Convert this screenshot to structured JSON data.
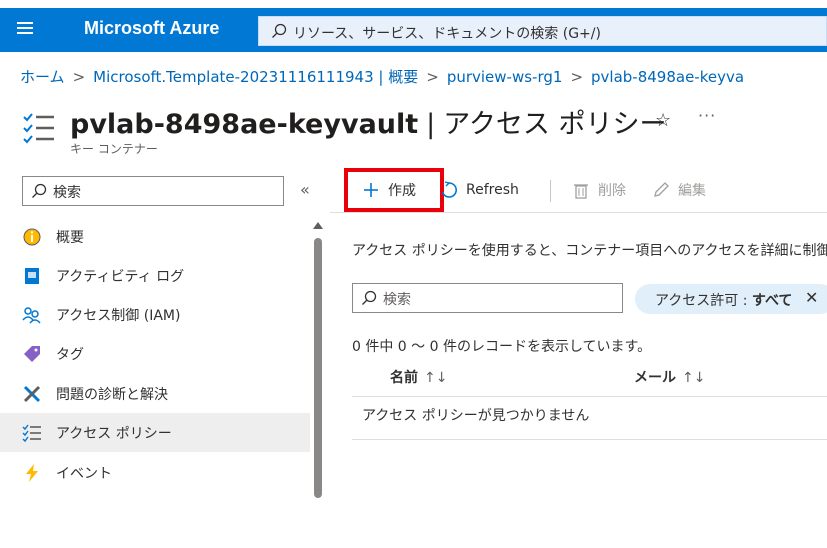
{
  "topbar": {
    "menu_icon": "hamburger-icon",
    "brand": "Microsoft Azure",
    "search_icon": "search-icon",
    "search_placeholder": "リソース、サービス、ドキュメントの検索 (G+/)"
  },
  "breadcrumb": {
    "items": [
      "ホーム",
      "Microsoft.Template-20231116111943 | 概要",
      "purview-ws-rg1",
      "pvlab-8498ae-keyva"
    ]
  },
  "header": {
    "icon": "access-policies-icon",
    "resource_name": "pvlab-8498ae-keyvault",
    "separator": "|",
    "page_name": "アクセス ポリシー",
    "star_icon": "star-icon",
    "more_icon": "ellipsis-icon",
    "subtitle": "キー コンテナー"
  },
  "sidebar": {
    "search_placeholder": "検索",
    "collapse": "«",
    "items": [
      {
        "label": "概要",
        "icon": "overview-icon"
      },
      {
        "label": "アクティビティ ログ",
        "icon": "activity-log-icon"
      },
      {
        "label": "アクセス制御 (IAM)",
        "icon": "iam-icon"
      },
      {
        "label": "タグ",
        "icon": "tag-icon"
      },
      {
        "label": "問題の診断と解決",
        "icon": "diagnose-icon"
      },
      {
        "label": "アクセス ポリシー",
        "icon": "access-policies-icon",
        "active": true
      },
      {
        "label": "イベント",
        "icon": "lightning-icon"
      }
    ]
  },
  "commandbar": {
    "create": "作成",
    "refresh": "Refresh",
    "delete": "削除",
    "edit": "編集"
  },
  "content": {
    "description": "アクセス ポリシーを使用すると、コンテナー項目へのアクセスを詳細に制御でき",
    "filter_placeholder": "検索",
    "pill_label": "アクセス許可 : ",
    "pill_value": "すべて",
    "pill_close": "✕",
    "record_count": "0 件中 0 ～ 0 件のレコードを表示しています。",
    "columns": [
      "名前",
      "メール"
    ],
    "sort_glyph": "↑↓",
    "empty_message": "アクセス ポリシーが見つかりません"
  },
  "colors": {
    "azure_blue": "#0078d4",
    "link": "#0067b8",
    "highlight_box": "#e8000b"
  }
}
